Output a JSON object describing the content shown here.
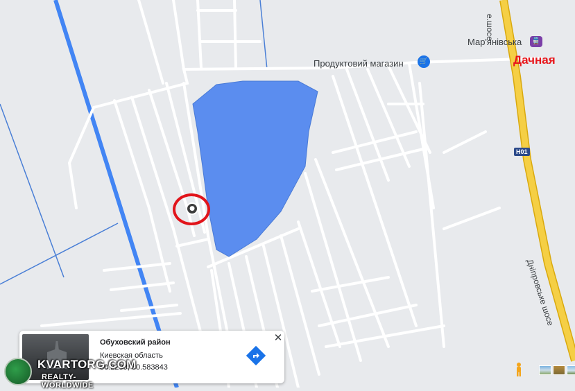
{
  "map": {
    "poi_store": "Продуктовий магазин",
    "poi_store_icon": "shopping-cart-icon",
    "station": "Мар'янівська",
    "station_icon": "train-station-icon",
    "highlight_label": "Дачная",
    "highway_shield": "H01",
    "road_name_top": "e.шосе",
    "road_name_vertical": "Дніпровське шосе",
    "water_color": "#5b8def",
    "highway_color": "#f2c62f",
    "railway_color": "#4285f4",
    "highlight_circle_color": "#e1141b"
  },
  "info_card": {
    "title": "Обуховский район",
    "region": "Киевская область",
    "coords": "50.2290, 30.583843",
    "close_label": "✕",
    "directions_icon": "directions-icon"
  },
  "watermark": {
    "main": "KVARTORG.COM",
    "sub": "REALTY-WORLDWIDE"
  },
  "controls": {
    "pegman_icon": "pegman-icon"
  }
}
